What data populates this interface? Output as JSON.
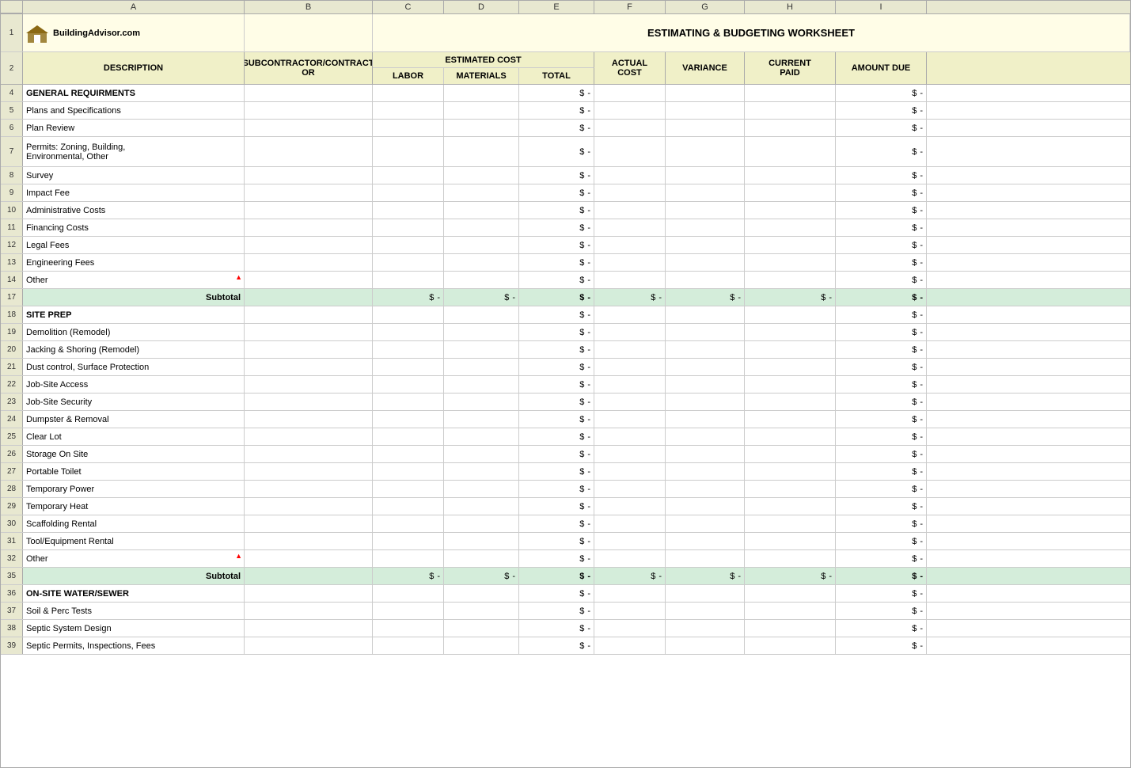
{
  "title": "ESTIMATING & BUDGETING WORKSHEET",
  "logo": "BuildingAdvisor.com",
  "columns": {
    "corner": "",
    "a_header": "A",
    "b_header": "B",
    "c_header": "C",
    "d_header": "D",
    "e_header": "E",
    "f_header": "F",
    "g_header": "G",
    "h_header": "H",
    "i_header": "I"
  },
  "headers": {
    "description": "DESCRIPTION",
    "subcontractor": "SUBCONTRACTOR/CONTRACT OR",
    "estimated_cost": "ESTIMATED COST",
    "labor": "LABOR",
    "materials": "MATERIALS",
    "total": "TOTAL",
    "actual_cost": "ACTUAL COST",
    "variance": "VARIANCE",
    "current_paid": "CURRENT PAID",
    "amount_due": "AMOUNT DUE"
  },
  "sections": [
    {
      "header": "GENERAL REQUIRMENTS",
      "row": 4,
      "rows": [
        {
          "num": 4,
          "desc": "GENERAL REQUIRMENTS",
          "is_section": true
        },
        {
          "num": 5,
          "desc": "Plans and Specifications"
        },
        {
          "num": 6,
          "desc": "Plan Review"
        },
        {
          "num": 7,
          "desc": "Permits: Zoning, Building, Environmental, Other",
          "double": true
        },
        {
          "num": 8,
          "desc": "Survey"
        },
        {
          "num": 9,
          "desc": "Impact Fee"
        },
        {
          "num": 10,
          "desc": "Administrative Costs"
        },
        {
          "num": 11,
          "desc": "Financing Costs"
        },
        {
          "num": 12,
          "desc": "Legal Fees"
        },
        {
          "num": 13,
          "desc": "Engineering Fees"
        },
        {
          "num": 14,
          "desc": "Other",
          "has_red_mark": true
        },
        {
          "num": 17,
          "desc": "Subtotal",
          "is_subtotal": true
        }
      ]
    },
    {
      "header": "SITE PREP",
      "rows": [
        {
          "num": 18,
          "desc": "SITE PREP",
          "is_section": true
        },
        {
          "num": 19,
          "desc": "Demolition (Remodel)"
        },
        {
          "num": 20,
          "desc": "Jacking & Shoring (Remodel)"
        },
        {
          "num": 21,
          "desc": "Dust control, Surface Protection"
        },
        {
          "num": 22,
          "desc": "Job-Site Access"
        },
        {
          "num": 23,
          "desc": "Job-Site Security"
        },
        {
          "num": 24,
          "desc": "Dumpster & Removal"
        },
        {
          "num": 25,
          "desc": "Clear Lot"
        },
        {
          "num": 26,
          "desc": "Storage On Site"
        },
        {
          "num": 27,
          "desc": "Portable Toilet"
        },
        {
          "num": 28,
          "desc": "Temporary Power"
        },
        {
          "num": 29,
          "desc": "Temporary Heat"
        },
        {
          "num": 30,
          "desc": "Scaffolding Rental"
        },
        {
          "num": 31,
          "desc": "Tool/Equipment Rental"
        },
        {
          "num": 32,
          "desc": "Other",
          "has_red_mark": true
        },
        {
          "num": 35,
          "desc": "Subtotal",
          "is_subtotal": true
        }
      ]
    },
    {
      "header": "ON-SITE WATER/SEWER",
      "rows": [
        {
          "num": 36,
          "desc": "ON-SITE WATER/SEWER",
          "is_section": true
        },
        {
          "num": 37,
          "desc": "Soil & Perc Tests"
        },
        {
          "num": 38,
          "desc": "Septic System Design"
        },
        {
          "num": 39,
          "desc": "Septic Permits, Inspections, Fees"
        }
      ]
    }
  ],
  "empty_value": "-",
  "dollar_sign": "$"
}
